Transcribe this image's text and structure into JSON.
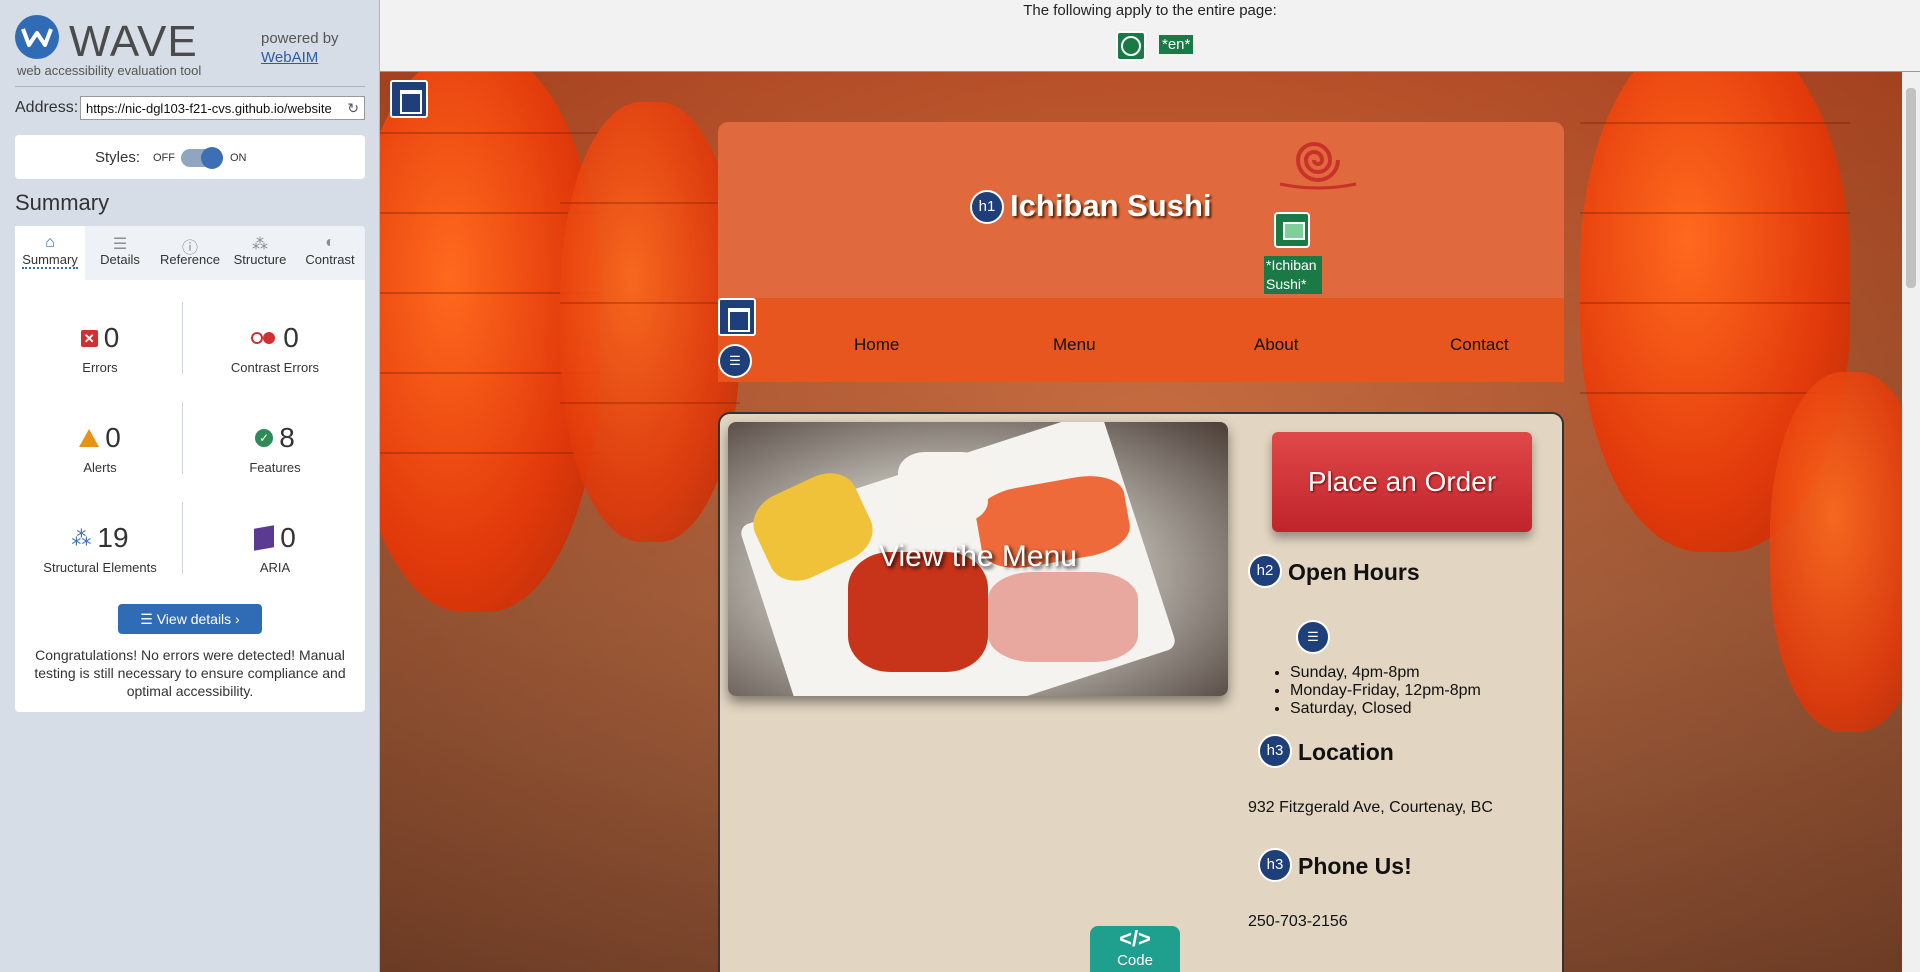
{
  "wave": {
    "name": "WAVE",
    "tagline": "web accessibility evaluation tool",
    "powered_by": "powered by",
    "webaim_link": "WebAIM",
    "address_label": "Address:",
    "address_value": "https://nic-dgl103-f21-cvs.github.io/website",
    "styles_label": "Styles:",
    "toggle_off": "OFF",
    "toggle_on": "ON",
    "summary_title": "Summary",
    "tabs": [
      {
        "label": "Summary",
        "icon": "home-icon"
      },
      {
        "label": "Details",
        "icon": "list-icon"
      },
      {
        "label": "Reference",
        "icon": "info-icon"
      },
      {
        "label": "Structure",
        "icon": "structure-icon"
      },
      {
        "label": "Contrast",
        "icon": "contrast-icon"
      }
    ],
    "stats": {
      "errors": {
        "count": "0",
        "label": "Errors"
      },
      "contrast_errors": {
        "count": "0",
        "label": "Contrast Errors"
      },
      "alerts": {
        "count": "0",
        "label": "Alerts"
      },
      "features": {
        "count": "8",
        "label": "Features"
      },
      "structural": {
        "count": "19",
        "label": "Structural Elements"
      },
      "aria": {
        "count": "0",
        "label": "ARIA"
      }
    },
    "view_details": "View details ›",
    "congrats": "Congratulations! No errors were detected! Manual testing is still necessary to ensure compliance and optimal accessibility."
  },
  "page_top": {
    "text": "The following apply to the entire page:",
    "lang_tag": "*en*"
  },
  "site": {
    "title": "Ichiban Sushi",
    "logo_alt_tag": "*Ichiban Sushi*",
    "nav": [
      "Home",
      "Menu",
      "About",
      "Contact"
    ],
    "menu_image_text": "View the Menu",
    "order_button": "Place an Order",
    "open_hours_heading": "Open Hours",
    "hours": [
      "Sunday, 4pm-8pm",
      "Monday-Friday, 12pm-8pm",
      "Saturday, Closed"
    ],
    "location_heading": "Location",
    "address": "932 Fitzgerald Ave, Courtenay, BC",
    "phone_heading": "Phone Us!",
    "phone": "250-703-2156"
  },
  "wave_markers": {
    "h1": "h1",
    "h2": "h2",
    "h3": "h3"
  },
  "code_tab": {
    "symbol": "</>",
    "label": "Code"
  },
  "colors": {
    "wave_blue": "#2f6cb5",
    "feature_green": "#1a7a46",
    "header_orange": "#e06a3e",
    "nav_orange": "#e8561f",
    "order_red": "#c0242c",
    "code_teal": "#1f9f8e"
  }
}
